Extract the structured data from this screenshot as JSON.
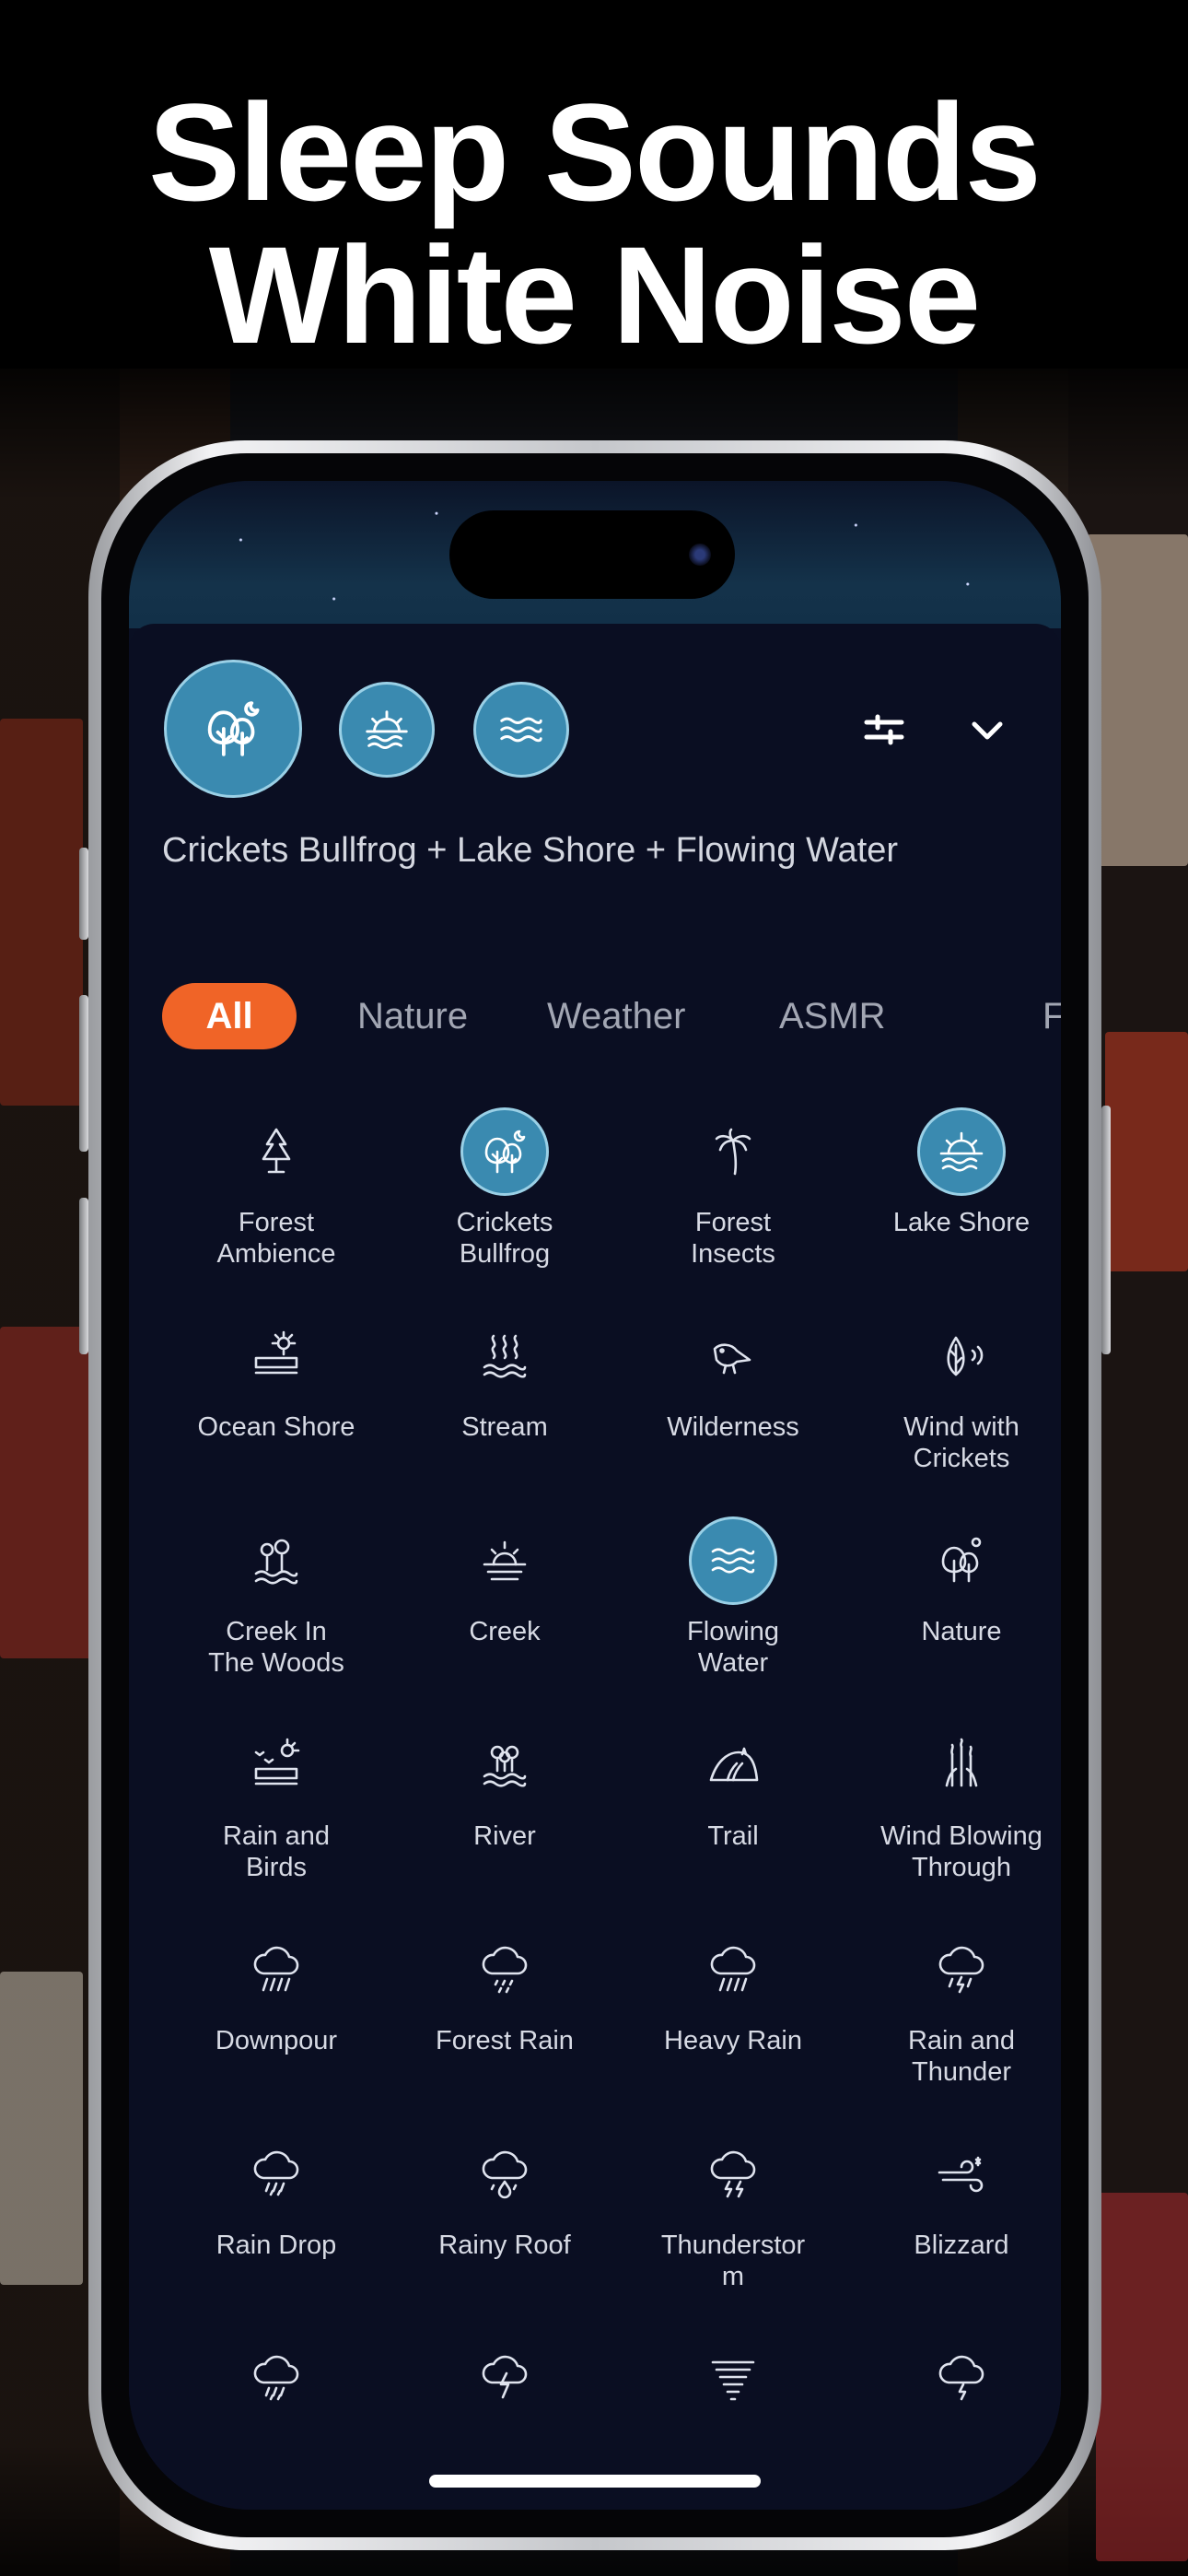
{
  "headline": {
    "line1": "Sleep Sounds",
    "line2": "White Noise"
  },
  "mix": {
    "title": "Crickets Bullfrog + Lake Shore + Flowing Water",
    "active_icons": [
      "trees-moon-icon",
      "sunrise-water-icon",
      "waves-icon"
    ],
    "accent_color": "#3a8ab0"
  },
  "header": {
    "settings_icon": "sliders-icon",
    "collapse_icon": "chevron-down-icon"
  },
  "tabs": [
    {
      "label": "All",
      "active": true
    },
    {
      "label": "Nature",
      "active": false
    },
    {
      "label": "Weather",
      "active": false
    },
    {
      "label": "ASMR",
      "active": false
    },
    {
      "label": "F",
      "active": false
    }
  ],
  "tab_active_color": "#f06427",
  "sounds": [
    {
      "label": "Forest\nAmbience",
      "icon": "pine-trees-icon",
      "selected": false
    },
    {
      "label": "Crickets\nBullfrog",
      "icon": "trees-moon-icon",
      "selected": true
    },
    {
      "label": "Forest\nInsects",
      "icon": "palm-tree-icon",
      "selected": false
    },
    {
      "label": "Lake Shore",
      "icon": "sunrise-water-icon",
      "selected": true
    },
    {
      "label": "Ocean Shore",
      "icon": "sun-shore-icon",
      "selected": false
    },
    {
      "label": "Stream",
      "icon": "steam-waves-icon",
      "selected": false
    },
    {
      "label": "Wilderness",
      "icon": "bird-icon",
      "selected": false
    },
    {
      "label": "Wind with\nCrickets",
      "icon": "leaf-sound-icon",
      "selected": false
    },
    {
      "label": "Creek In\nThe Woods",
      "icon": "trees-water-icon",
      "selected": false
    },
    {
      "label": "Creek",
      "icon": "sunset-water-icon",
      "selected": false
    },
    {
      "label": "Flowing\nWater",
      "icon": "waves-icon",
      "selected": true
    },
    {
      "label": "Nature",
      "icon": "trees-sun-icon",
      "selected": false
    },
    {
      "label": "Rain and\nBirds",
      "icon": "sun-birds-icon",
      "selected": false
    },
    {
      "label": "River",
      "icon": "river-trees-icon",
      "selected": false
    },
    {
      "label": "Trail",
      "icon": "hill-trail-icon",
      "selected": false
    },
    {
      "label": "Wind Blowing\nThrough",
      "icon": "reeds-icon",
      "selected": false
    },
    {
      "label": "Downpour",
      "icon": "cloud-heavy-rain-icon",
      "selected": false
    },
    {
      "label": "Forest Rain",
      "icon": "cloud-drizzle-icon",
      "selected": false
    },
    {
      "label": "Heavy Rain",
      "icon": "cloud-heavy-rain-icon",
      "selected": false
    },
    {
      "label": "Rain and\nThunder",
      "icon": "cloud-thunder-rain-icon",
      "selected": false
    },
    {
      "label": "Rain Drop",
      "icon": "cloud-rain-icon",
      "selected": false
    },
    {
      "label": "Rainy Roof",
      "icon": "cloud-drop-icon",
      "selected": false
    },
    {
      "label": "Thunderstor\nm",
      "icon": "cloud-storm-icon",
      "selected": false
    },
    {
      "label": "Blizzard",
      "icon": "wind-snow-icon",
      "selected": false
    },
    {
      "label": "",
      "icon": "cloud-rain-icon",
      "selected": false
    },
    {
      "label": "",
      "icon": "cloud-lightning-icon",
      "selected": false
    },
    {
      "label": "",
      "icon": "tornado-icon",
      "selected": false
    },
    {
      "label": "",
      "icon": "cloud-bolt-icon",
      "selected": false
    }
  ]
}
